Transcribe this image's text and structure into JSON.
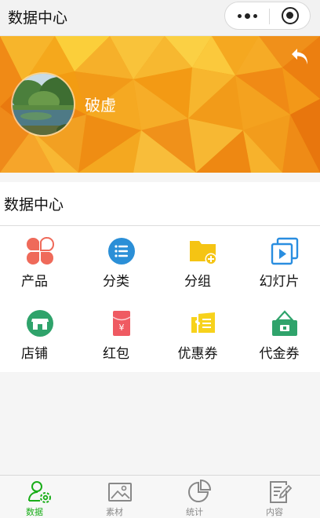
{
  "navbar": {
    "title": "数据中心"
  },
  "profile": {
    "name": "破虚"
  },
  "section": {
    "title": "数据中心",
    "items": [
      {
        "label": "产品",
        "icon": "product-icon"
      },
      {
        "label": "分类",
        "icon": "list-icon"
      },
      {
        "label": "分组",
        "icon": "folder-add-icon"
      },
      {
        "label": "幻灯片",
        "icon": "slideshow-icon"
      },
      {
        "label": "店铺",
        "icon": "shop-icon"
      },
      {
        "label": "红包",
        "icon": "red-envelope-icon"
      },
      {
        "label": "优惠券",
        "icon": "coupon-icon"
      },
      {
        "label": "代金券",
        "icon": "voucher-icon"
      }
    ]
  },
  "tabbar": {
    "tabs": [
      {
        "label": "数据",
        "active": true
      },
      {
        "label": "素材",
        "active": false
      },
      {
        "label": "统计",
        "active": false
      },
      {
        "label": "内容",
        "active": false
      }
    ]
  },
  "colors": {
    "accent": "#1aad19",
    "banner": "#f29a10",
    "product": "#ef6a5a",
    "list": "#2b8fd7",
    "folder": "#f5c413",
    "slide": "#2a8ee0",
    "shop": "#2fa36b",
    "redpack": "#ef5a62",
    "coupon": "#f7d21c",
    "voucher": "#2fa36b"
  }
}
